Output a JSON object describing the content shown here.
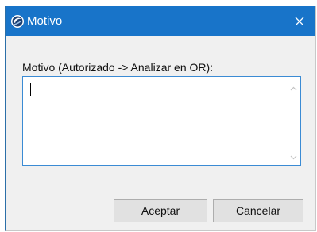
{
  "dialog": {
    "title": "Motivo",
    "prompt": "Motivo (Autorizado -> Analizar en OR):",
    "input_value": "",
    "accept_label": "Aceptar",
    "cancel_label": "Cancelar"
  },
  "colors": {
    "titlebar": "#1874c9",
    "title_text": "#ffffff",
    "body": "#f0f0f0",
    "input_border": "#3b8bd4",
    "button_face": "#e1e1e1"
  },
  "icons": {
    "app": "app-logo-icon",
    "close": "close-icon",
    "scroll_up": "chevron-up-icon",
    "scroll_down": "chevron-down-icon"
  }
}
